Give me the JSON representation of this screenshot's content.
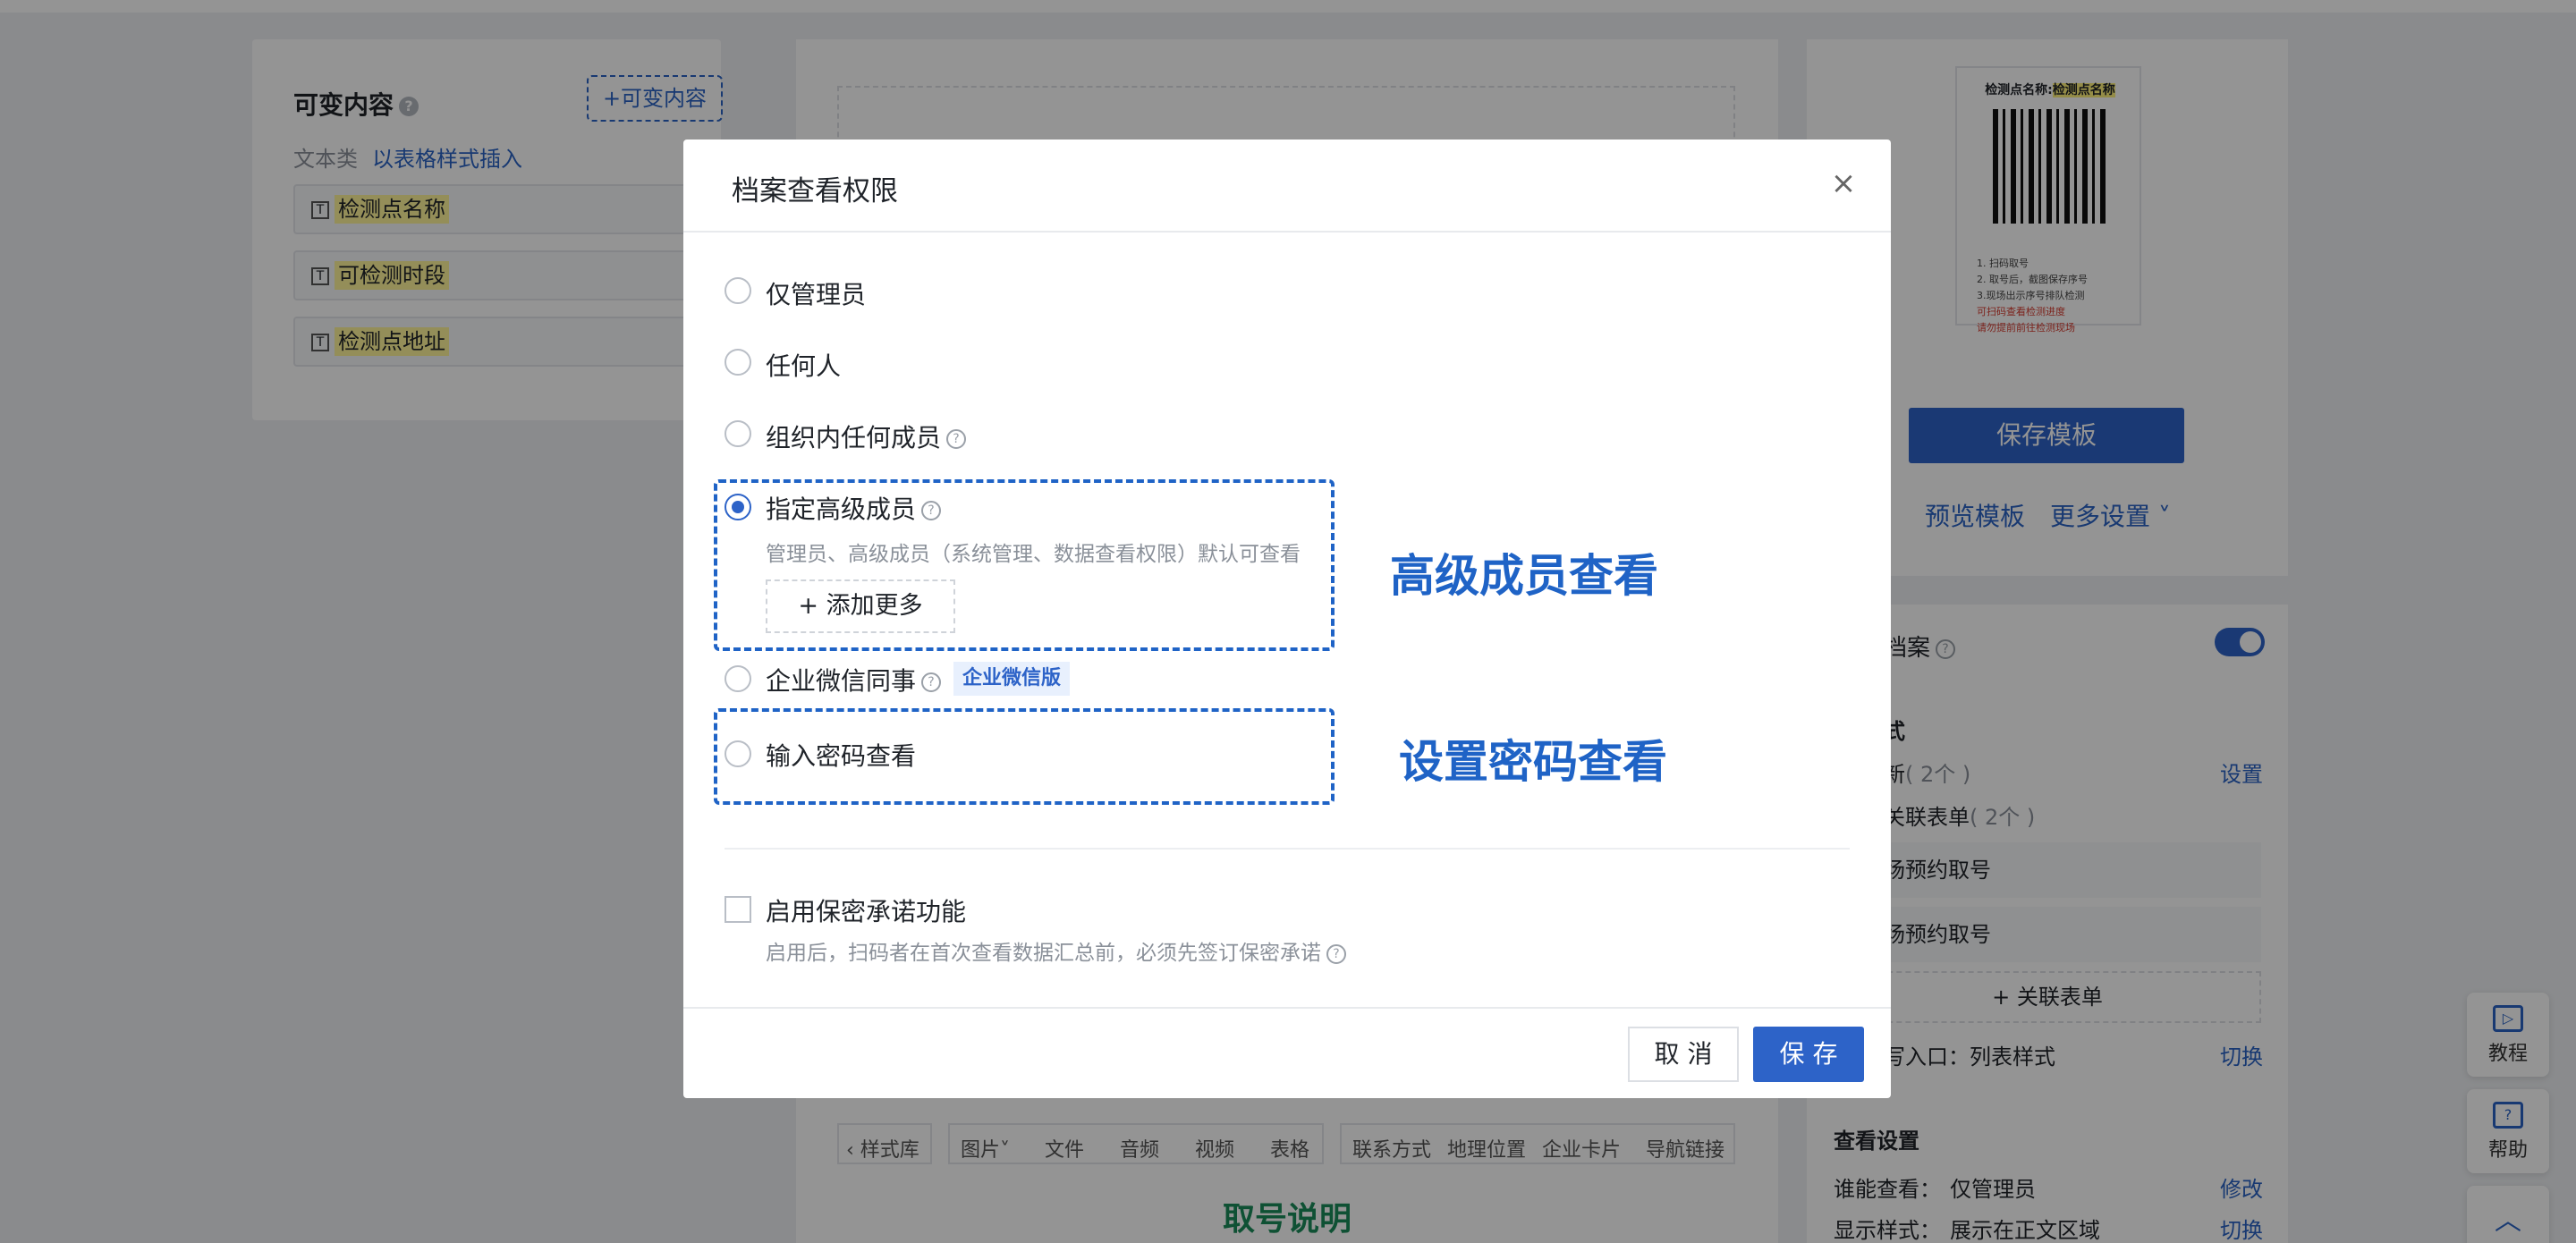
{
  "left_panel": {
    "title": "可变内容",
    "help_glyph": "?",
    "add_button": "+可变内容",
    "category_label": "文本类",
    "insert_link": "以表格样式插入",
    "field_icon_glyph": "T",
    "fields": [
      "检测点名称",
      "可检测时段",
      "检测点地址"
    ]
  },
  "editor": {
    "toolbar": [
      "‹ 样式库",
      "图片˅",
      "文件",
      "音频",
      "视频",
      "表格",
      "联系方式",
      "地理位置",
      "企业卡片",
      "导航链接"
    ],
    "heading": "取号说明"
  },
  "preview": {
    "qr_title_prefix": "检测点名称:",
    "qr_title_value": "检测点名称",
    "qr_notes": [
      "1. 扫码取号",
      "2. 取号后，截图保存序号",
      "3.现场出示序号排队检测"
    ],
    "qr_notes_red": [
      "可扫码查看检测进度",
      "请勿提前前往检测现场"
    ],
    "save_template": "保存模板",
    "preview_template": "预览模板",
    "more_settings": "更多设置 ˅"
  },
  "archive_panel": {
    "title": "档案",
    "title_help": "?",
    "section_style": "式",
    "update_label": "新",
    "update_count": "( 2个 )",
    "set_link": "设置",
    "linked_forms_label": "关联表单",
    "linked_forms_count": "( 2个 )",
    "rows": [
      "场预约取号",
      "场预约取号"
    ],
    "add_link_form": "+ 关联表单",
    "entry_label": "写入口：列表样式",
    "switch_1": "切换",
    "view_settings_title": "查看设置",
    "who_can_view_label": "谁能查看：",
    "who_can_view_value": "仅管理员",
    "modify_link": "修改",
    "display_style_label": "显示样式：",
    "display_style_value": "展示在正文区域",
    "switch_2": "切换"
  },
  "floating": {
    "tutorial": "教程",
    "tutorial_glyph": "▷",
    "help": "帮助",
    "help_glyph": "?",
    "top_glyph": "︿"
  },
  "modal": {
    "title": "档案查看权限",
    "close_glyph": "×",
    "help_glyph": "?",
    "options": {
      "admin_only": "仅管理员",
      "anyone": "任何人",
      "org_members": "组织内任何成员",
      "senior_members": "指定高级成员",
      "senior_hint": "管理员、高级成员（系统管理、数据查看权限）默认可查看",
      "add_more": "+  添加更多",
      "wecom": "企业微信同事",
      "wecom_tag": "企业微信版",
      "password": "输入密码查看"
    },
    "selected_option": "指定高级成员",
    "confidentiality": {
      "label": "启用保密承诺功能",
      "hint": "启用后，扫码者在首次查看数据汇总前，必须先签订保密承诺",
      "checked": false
    },
    "cancel": "取 消",
    "save": "保 存"
  },
  "annotations": {
    "senior": "高级成员查看",
    "password": "设置密码查看",
    "color": "#1f63c6"
  },
  "colors": {
    "primary": "#2d63c8",
    "overlay": "rgba(0,0,0,0.42)"
  }
}
